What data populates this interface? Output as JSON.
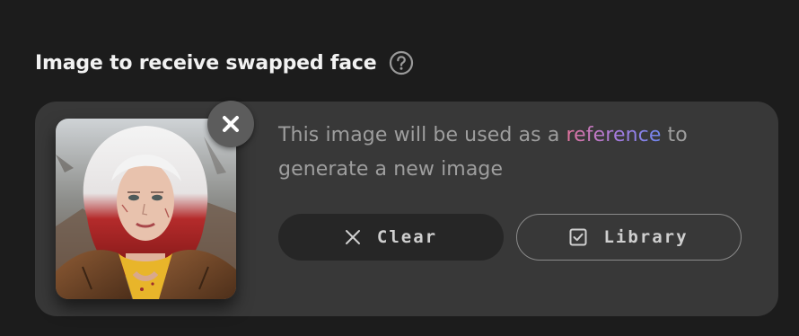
{
  "section": {
    "title": "Image to receive swapped face",
    "help_icon": "question-circle-icon"
  },
  "card": {
    "description_prefix": "This image will be used as a ",
    "description_highlight": "reference",
    "description_suffix": " to generate a new image",
    "highlight_gradient": [
      "#e0739c",
      "#a47be0",
      "#6f86ec"
    ],
    "remove_icon": "close-icon",
    "image_alt": "Woman with white and red hair in a brown leather jacket"
  },
  "buttons": {
    "clear_label": "Clear",
    "clear_icon": "x-icon",
    "library_label": "Library",
    "library_icon": "checkbox-icon"
  },
  "colors": {
    "background": "#1c1c1c",
    "card": "#383838",
    "clear_button": "#262626",
    "remove_button": "#5c5c5c"
  }
}
